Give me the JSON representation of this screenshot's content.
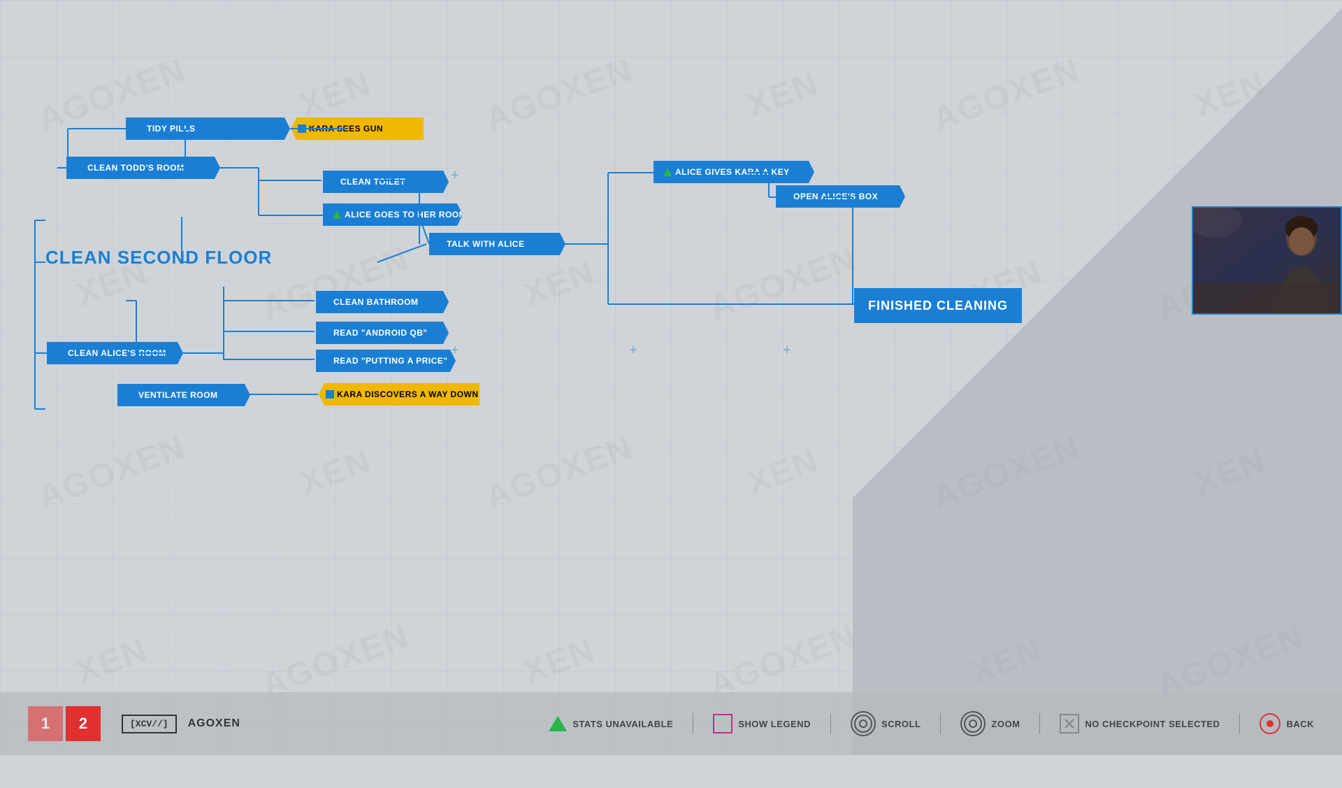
{
  "watermark": {
    "text": "AGOXEN"
  },
  "nodes": {
    "tidy_pills": "TIDY PILLS",
    "kara_sees_gun": "KARA SEES GUN",
    "clean_todds_room": "CLEAN TODD'S ROOM",
    "clean_toilet": "CLEAN TOILET",
    "alice_goes_to_her_room": "ALICE GOES TO HER ROOM",
    "clean_second_floor": "CLEAN SECOND FLOOR",
    "talk_with_alice": "TALK WITH ALICE",
    "alice_gives_kara_key": "ALICE GIVES KARA A KEY",
    "open_alices_box": "OPEN ALICE'S BOX",
    "finished_cleaning": "FINISHED CLEANING",
    "clean_bathroom": "CLEAN BATHROOM",
    "read_android_qb": "READ \"ANDROID QB\"",
    "read_putting_a_price": "READ \"PUTTING A PRICE\"",
    "clean_alices_room": "CLEAN ALICE'S ROOM",
    "ventilate_room": "VENTILATE ROOM",
    "kara_discovers_way_down": "KARA DISCOVERS A WAY DOWN"
  },
  "bottom_bar": {
    "page1": "1",
    "page2": "2",
    "logo": "[XCV//]",
    "brand": "AGOXEN",
    "stats_unavailable": "STATS UNAVAILABLE",
    "show_legend": "SHOW LEGEND",
    "scroll": "SCROLL",
    "zoom": "ZOOM",
    "no_checkpoint": "NO CHECKPOINT SELECTED",
    "back": "BACK"
  },
  "colors": {
    "blue": "#1a7fd4",
    "yellow": "#f0b800",
    "red": "#e03030",
    "green": "#2ab54a",
    "pink": "#c03080",
    "dark": "#333333",
    "bg": "#d0d4d8"
  }
}
